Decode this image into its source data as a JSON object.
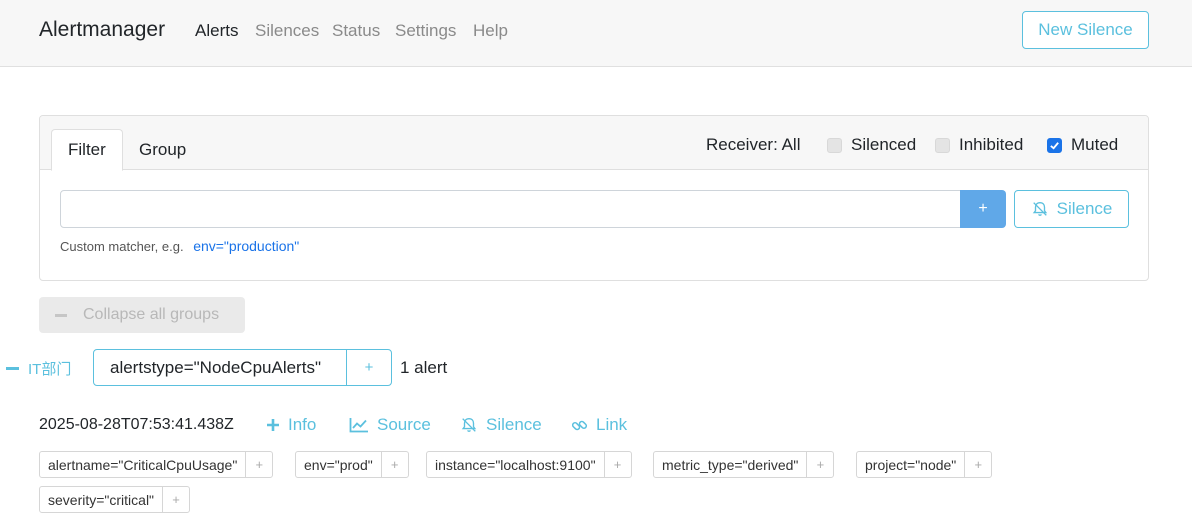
{
  "navbar": {
    "brand": "Alertmanager",
    "links": [
      "Alerts",
      "Silences",
      "Status",
      "Settings",
      "Help"
    ],
    "new_silence_label": "New Silence"
  },
  "filter": {
    "tabs": [
      "Filter",
      "Group"
    ],
    "receiver_label": "Receiver: All",
    "checkboxes": [
      {
        "label": "Silenced",
        "checked": false
      },
      {
        "label": "Inhibited",
        "checked": false
      },
      {
        "label": "Muted",
        "checked": true
      }
    ],
    "input_value": "",
    "input_placeholder": "",
    "add_label": "+",
    "silence_label": "Silence",
    "hint_text": "Custom matcher, e.g.",
    "hint_example": "env=\"production\""
  },
  "collapse_label": "Collapse all groups",
  "group": {
    "name": "IT部门",
    "label": "alertstype=\"NodeCpuAlerts\"",
    "plus": "+",
    "count_text": "1 alert"
  },
  "alert": {
    "timestamp": "2025-08-28T07:53:41.438Z",
    "actions": [
      "Info",
      "Source",
      "Silence",
      "Link"
    ],
    "labels": [
      "alertname=\"CriticalCpuUsage\"",
      "env=\"prod\"",
      "instance=\"localhost:9100\"",
      "metric_type=\"derived\"",
      "project=\"node\"",
      "severity=\"critical\""
    ],
    "label_plus": "+"
  },
  "colors": {
    "accent": "#5bc0de",
    "primary": "#1a73e8"
  }
}
